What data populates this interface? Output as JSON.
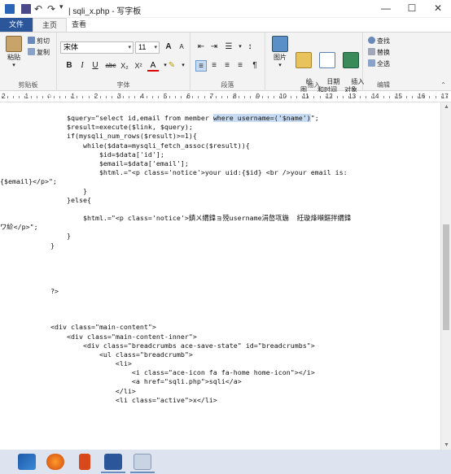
{
  "window": {
    "title": "sqli_x.php - 写字板",
    "separator": "|",
    "min": "—",
    "max": "☐",
    "close": "✕"
  },
  "tabs": {
    "file": "文件",
    "home": "主页",
    "view": "查看"
  },
  "ribbon": {
    "clipboard": {
      "label": "剪贴板",
      "paste": "粘贴",
      "cut": "剪切",
      "copy": "复制"
    },
    "font": {
      "label": "字体",
      "family": "宋体",
      "size": "11",
      "grow": "A",
      "shrink": "A",
      "bold": "B",
      "italic": "I",
      "underline": "U",
      "strike": "abc",
      "subscript": "X₂",
      "superscript": "X²"
    },
    "paragraph": {
      "label": "段落"
    },
    "insert": {
      "label": "插入",
      "picture": "图片",
      "paint": "绘\n图",
      "datetime": "日期\n和时间",
      "object": "插入\n对象"
    },
    "editing": {
      "label": "编辑",
      "find": "查找",
      "replace": "替换",
      "selectall": "全选"
    }
  },
  "ruler": {
    "marks": [
      "2",
      "1",
      "1",
      "2",
      "3",
      "4",
      "5",
      "6",
      "7",
      "8",
      "9",
      "10",
      "11",
      "12",
      "13",
      "14",
      "15",
      "16",
      "17"
    ]
  },
  "document": {
    "lines": [
      {
        "pre": "    $query=\"select id,email from member ",
        "hl": "where username=('$name')",
        "post": "\";"
      },
      {
        "pre": "    $result=execute($link, $query);",
        "hl": "",
        "post": ""
      },
      {
        "pre": "    if(mysqli_num_rows($result)>=1){",
        "hl": "",
        "post": ""
      },
      {
        "pre": "        while($data=mysqli_fetch_assoc($result)){",
        "hl": "",
        "post": ""
      },
      {
        "pre": "            $id=$data['id'];",
        "hl": "",
        "post": ""
      },
      {
        "pre": "            $email=$data['email'];",
        "hl": "",
        "post": ""
      },
      {
        "pre": "            $html.=\"<p class='notice'>your uid:{$id} <br />your email is:",
        "hl": "",
        "post": ""
      },
      {
        "pre": "{$email}</p>\";",
        "hl": "",
        "post": ""
      },
      {
        "pre": "        }",
        "hl": "",
        "post": ""
      },
      {
        "pre": "    }else{",
        "hl": "",
        "post": ""
      },
      {
        "pre": "",
        "hl": "",
        "post": ""
      },
      {
        "pre": "        $html.=\"<p class='notice'>鎮ㄨ緭鍏ョ殑username涓嶅瓨鍦  紝璇烽噸鏂拌緭鍏",
        "hl": "",
        "post": ""
      },
      {
        "pre": "ワ紒</p>\";",
        "hl": "",
        "post": ""
      },
      {
        "pre": "    }",
        "hl": "",
        "post": ""
      },
      {
        "pre": "}",
        "hl": "",
        "post": ""
      },
      {
        "pre": "",
        "hl": "",
        "post": ""
      },
      {
        "pre": "",
        "hl": "",
        "post": ""
      },
      {
        "pre": "",
        "hl": "",
        "post": ""
      },
      {
        "pre": "",
        "hl": "",
        "post": ""
      },
      {
        "pre": "?>",
        "hl": "",
        "post": ""
      },
      {
        "pre": "",
        "hl": "",
        "post": ""
      },
      {
        "pre": "",
        "hl": "",
        "post": ""
      },
      {
        "pre": "",
        "hl": "",
        "post": ""
      },
      {
        "pre": "<div class=\"main-content\">",
        "hl": "",
        "post": ""
      },
      {
        "pre": "    <div class=\"main-content-inner\">",
        "hl": "",
        "post": ""
      },
      {
        "pre": "        <div class=\"breadcrumbs ace-save-state\" id=\"breadcrumbs\">",
        "hl": "",
        "post": ""
      },
      {
        "pre": "            <ul class=\"breadcrumb\">",
        "hl": "",
        "post": ""
      },
      {
        "pre": "                <li>",
        "hl": "",
        "post": ""
      },
      {
        "pre": "                    <i class=\"ace-icon fa fa-home home-icon\"></i>",
        "hl": "",
        "post": ""
      },
      {
        "pre": "                    <a href=\"sqli.php\">sqli</a>",
        "hl": "",
        "post": ""
      },
      {
        "pre": "                </li>",
        "hl": "",
        "post": ""
      },
      {
        "pre": "                <li class=\"active\">x</li>",
        "hl": "",
        "post": ""
      }
    ]
  },
  "colors": {
    "file_tab": "#2b579a",
    "selection": "#c7dcf2",
    "taskbar": "#dde4ef"
  }
}
